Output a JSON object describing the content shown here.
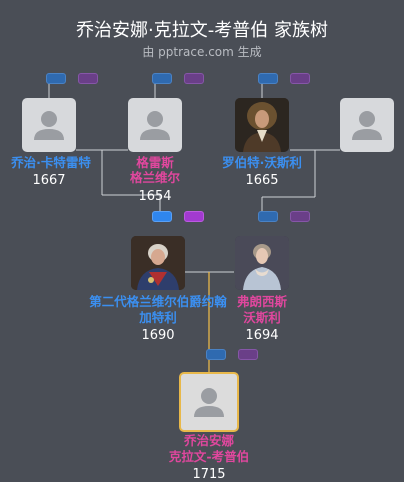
{
  "header": {
    "title": "乔治安娜·克拉文-考普伯 家族树",
    "subtitle": "由 pptrace.com 生成"
  },
  "people": {
    "george_carteret": {
      "name": "乔治·卡特雷特",
      "year": "1667",
      "gender": "male",
      "photo": false
    },
    "grace_granville": {
      "name_line1": "格雷斯",
      "name_line2": "格兰维尔",
      "year": "1654",
      "gender": "female",
      "photo": false
    },
    "robert_worsley": {
      "name": "罗伯特·沃斯利",
      "year": "1665",
      "gender": "male",
      "photo": true
    },
    "unknown_wife": {
      "gender": "female",
      "photo": false
    },
    "john_carteret": {
      "name_line1": "第二代格兰维尔伯爵约翰",
      "name_line2": "加特利",
      "year": "1690",
      "gender": "male",
      "photo": true
    },
    "frances_worsley": {
      "name_line1": "弗朗西斯",
      "name_line2": "沃斯利",
      "year": "1694",
      "gender": "female",
      "photo": true
    },
    "georgiana": {
      "name_line1": "乔治安娜",
      "name_line2": "克拉文-考普伯",
      "year": "1715",
      "gender": "female",
      "photo": false,
      "focus": true
    }
  },
  "colors": {
    "background": "#4a4e56",
    "male": "#3b8ff0",
    "female": "#e0479e",
    "focus_border": "#e8b84a",
    "line": "#cfd2d6",
    "focus_line": "#e8b84a"
  }
}
